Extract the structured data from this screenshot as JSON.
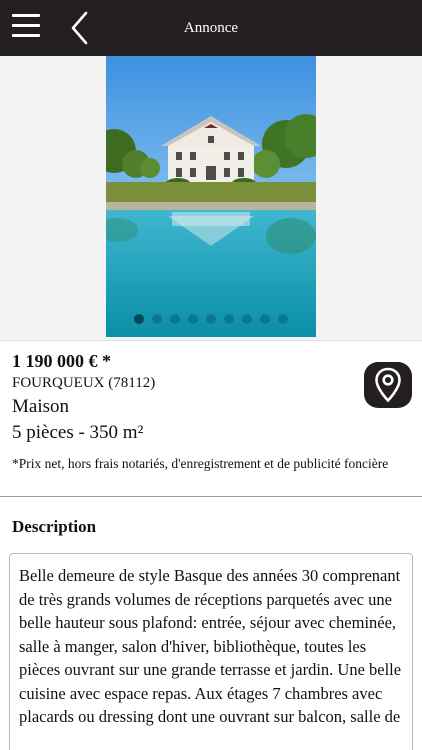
{
  "header": {
    "title": "Annonce",
    "menu_icon": "hamburger-menu-icon",
    "back_icon": "chevron-left-icon",
    "background": "#231f20"
  },
  "gallery": {
    "image": "house-with-pool-photo",
    "slide_count": 9,
    "active_slide": 1
  },
  "listing": {
    "price": "1 190 000 € *",
    "location": "FOURQUEUX (78112)",
    "property_type": "Maison",
    "rooms_area": "5 pièces - 350 m²",
    "price_note": "*Prix net, hors frais notariés, d'enregistrement et de publicité foncière",
    "map_icon": "map-pin-icon"
  },
  "description": {
    "heading": "Description",
    "text": "Belle demeure de style Basque des années 30 comprenant de très grands volumes de réceptions parquetés avec une belle hauteur sous plafond: entrée, séjour avec cheminée, salle à manger, salon d'hiver, bibliothèque, toutes les pièces ouvrant sur une grande terrasse et jardin. Une belle cuisine avec espace repas. Aux étages 7 chambres avec placards ou dressing dont une ouvrant sur balcon, salle de"
  }
}
